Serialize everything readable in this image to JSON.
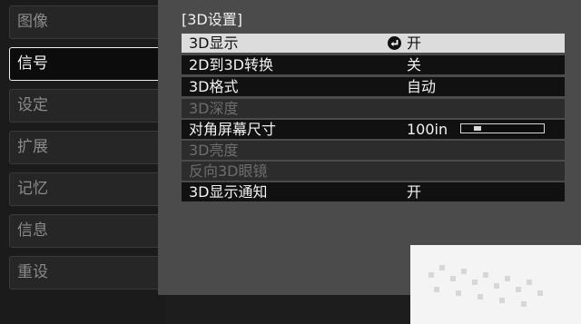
{
  "sidebar": {
    "items": [
      {
        "label": "图像",
        "active": false
      },
      {
        "label": "信号",
        "active": true
      },
      {
        "label": "设定",
        "active": false
      },
      {
        "label": "扩展",
        "active": false
      },
      {
        "label": "记忆",
        "active": false
      },
      {
        "label": "信息",
        "active": false
      },
      {
        "label": "重设",
        "active": false
      }
    ]
  },
  "panel": {
    "title": "[3D设置]",
    "rows": [
      {
        "label": "3D显示",
        "value": "开",
        "state": "selected",
        "has_enter_icon": true
      },
      {
        "label": "2D到3D转换",
        "value": "关",
        "state": "normal"
      },
      {
        "label": "3D格式",
        "value": "自动",
        "state": "normal"
      },
      {
        "label": "3D深度",
        "value": "",
        "state": "disabled"
      },
      {
        "label": "对角屏幕尺寸",
        "value": "100in",
        "state": "normal",
        "slider_level": 0.15
      },
      {
        "label": "3D亮度",
        "value": "",
        "state": "disabled"
      },
      {
        "label": "反向3D眼镜",
        "value": "",
        "state": "disabled"
      },
      {
        "label": "3D显示通知",
        "value": "开",
        "state": "normal"
      }
    ]
  },
  "icons": {
    "enter": "enter-arrow-icon"
  },
  "colors": {
    "panel_bg": "#4b4b4b",
    "row_bg": "#111111",
    "selected_bg": "#dcdcdc",
    "disabled_text": "#6d6d6d"
  }
}
